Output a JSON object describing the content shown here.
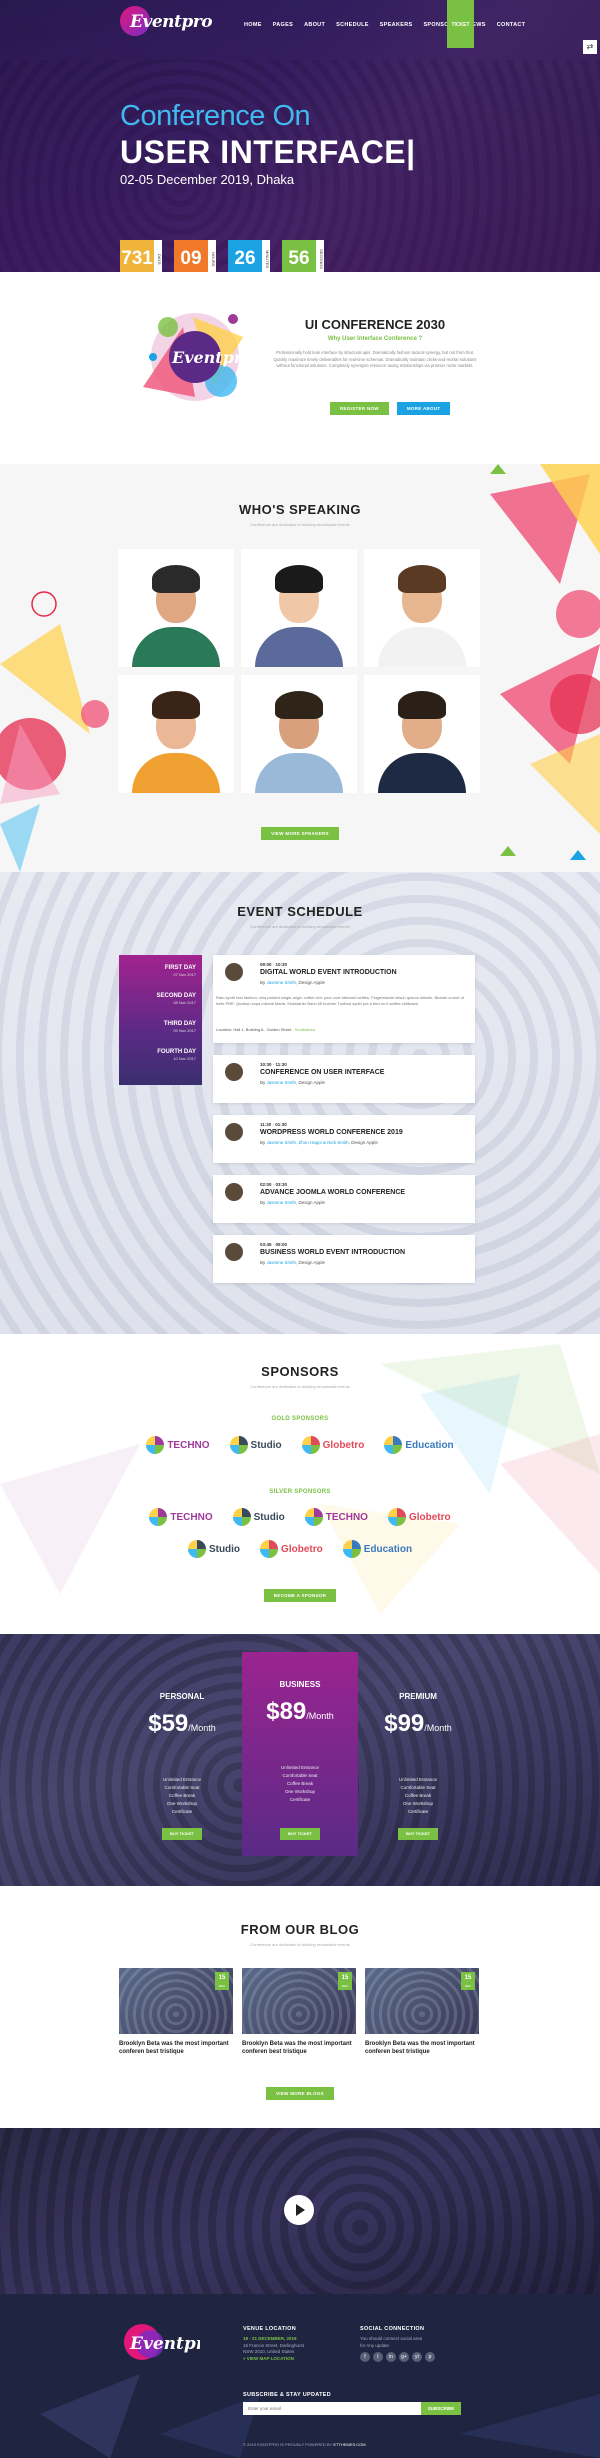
{
  "nav": {
    "logo": "Eventpro",
    "items": [
      "HOME",
      "PAGES",
      "ABOUT",
      "SCHEDULE",
      "SPEAKERS",
      "SPONSORS",
      "NEWS",
      "CONTACT"
    ],
    "ticket": "TICKET",
    "share_icon": "share-icon"
  },
  "hero": {
    "title_line1": "Conference On",
    "title_line2": "USER INTERFACE|",
    "subtitle": "02-05 December 2019, Dhaka",
    "countdown": [
      {
        "value": "731",
        "unit": "DAYS",
        "color": "#f0b43a"
      },
      {
        "value": "09",
        "unit": "HOURS",
        "color": "#f07a2a"
      },
      {
        "value": "26",
        "unit": "MINUTES",
        "color": "#1ba2e2"
      },
      {
        "value": "56",
        "unit": "SECONDS",
        "color": "#7ac143"
      }
    ]
  },
  "about": {
    "logo": "Eventpro",
    "title": "UI CONFERENCE 2030",
    "subtitle": "Why User Interface Conference ?",
    "text": "Professionally hold lean interface by structural apis. Dramatically fashion tactical synergy, but not from that. Quickly maximize timely deliverables for real-time schemas. Dramatically maintain clicks-and-mortar solutions without functional solutions. Completely synergize resource taxing relationships via premier niche markets.",
    "register": "REGISTER NOW",
    "more": "MORE ABOUT"
  },
  "speakers": {
    "title": "WHO'S SPEAKING",
    "sub": "Conference are dedicated to building remarkable events",
    "button": "VIEW MORE SPEAKERS",
    "people": [
      {
        "hair": "#2a2a2a",
        "body": "#2a7a5a",
        "skin": "#e0a882"
      },
      {
        "hair": "#1a1a1a",
        "body": "#5a6a9a",
        "skin": "#f0c8a8"
      },
      {
        "hair": "#5a3a22",
        "body": "#f2f2f2",
        "skin": "#e6b690"
      },
      {
        "hair": "#3a2418",
        "body": "#f0a030",
        "skin": "#eab896"
      },
      {
        "hair": "#2e2418",
        "body": "#9ab8d8",
        "skin": "#d8a07c"
      },
      {
        "hair": "#2a2018",
        "body": "#1e2a44",
        "skin": "#e2ae8a"
      }
    ]
  },
  "schedule": {
    "title": "EVENT SCHEDULE",
    "sub": "Conference are dedicated to building remarkable events",
    "days": [
      {
        "name": "FIRST DAY",
        "date": "07 Nov 2017"
      },
      {
        "name": "SECOND DAY",
        "date": "08 Nov 2017"
      },
      {
        "name": "THIRD DAY",
        "date": "09 Nov 2017"
      },
      {
        "name": "FOURTH DAY",
        "date": "10 Nov 2017"
      }
    ],
    "events": [
      {
        "start": "09:00",
        "end": "10:30",
        "title": "DIGITAL WORLD EVENT INTRODUCTION",
        "speakers": "Jasmine Smith",
        "role": ", Design Apple"
      },
      {
        "start": "10:30",
        "end": "11:30",
        "title": "CONFERENCE ON USER INTERFACE",
        "speakers": "Jasmine Smith",
        "role": ", Design Apple"
      },
      {
        "start": "11:30",
        "end": "01:30",
        "title": "WORDPRESS WORLD CONFERENCE 2019",
        "speakers": "Jasmine Smith, Zhon Happi & Nick Smith",
        "role": ", Design Apple"
      },
      {
        "start": "02:00",
        "end": "03:30",
        "title": "ADVANCE JOOMLA WORLD CONFERENCE",
        "speakers": "Jasmine Smith",
        "role": ", Design Apple"
      },
      {
        "start": "03:45",
        "end": "05:00",
        "title": "BUSINESS WORLD EVENT INTRODUCTION",
        "speakers": "Jasmine Smith",
        "role": ", Design Apple"
      }
    ],
    "first_desc": "Rafo synth fast fashion, chia pickled single-origin coffee vice pour-over tattooed selfies. Fingerstache kitsch quinoa mlkshk. Beards cronut of hella PBR. Quatron kopa mlkshk Marfa, Kickstarter Banh Mi butcher Truffaut synth put a bird on it selfies chillwave.",
    "location_label": "Location:",
    "location": "Hall 1, Building A , Golden Street ,",
    "location_city": "Southafrica"
  },
  "sponsors": {
    "title": "SPONSORS",
    "sub": "Conference are dedicated to building remarkable events",
    "gold": "GOLD SPONSORS",
    "silver": "SILVER SPONSORS",
    "button": "BECOME A SPONSOR",
    "gold_logos": [
      {
        "name": "TECHNO",
        "color": "#a03a9a"
      },
      {
        "name": "Studio",
        "color": "#3a4a5a"
      },
      {
        "name": "Globetro",
        "color": "#e04a5a"
      },
      {
        "name": "Education",
        "color": "#3a7ac0"
      }
    ],
    "silver_row1": [
      {
        "name": "TECHNO",
        "color": "#a03a9a"
      },
      {
        "name": "Studio",
        "color": "#3a4a5a"
      },
      {
        "name": "TECHNO",
        "color": "#a03a9a"
      },
      {
        "name": "Globetro",
        "color": "#e04a5a"
      }
    ],
    "silver_row2": [
      {
        "name": "Studio",
        "color": "#3a4a5a"
      },
      {
        "name": "Globetro",
        "color": "#e04a5a"
      },
      {
        "name": "Education",
        "color": "#3a7ac0"
      }
    ]
  },
  "pricing": {
    "plans": [
      {
        "name": "PERSONAL",
        "currency": "$",
        "amount": "59",
        "period": "/Month",
        "features": [
          "Unlimited Entrance",
          "Comfortable Seat",
          "Coffee Break",
          "One Workshop",
          "Certificate"
        ],
        "button": "BUY TICKET"
      },
      {
        "name": "BUSINESS",
        "currency": "$",
        "amount": "89",
        "period": "/Month",
        "features": [
          "Unlimited Entrance",
          "Comfortable Seat",
          "Coffee Break",
          "One Workshop",
          "Certificate"
        ],
        "button": "BUY TICKET"
      },
      {
        "name": "PREMIUM",
        "currency": "$",
        "amount": "99",
        "period": "/Month",
        "features": [
          "Unlimited Entrance",
          "Comfortable Seat",
          "Coffee Break",
          "One Workshop",
          "Certificate"
        ],
        "button": "BUY TICKET"
      }
    ]
  },
  "blog": {
    "title": "FROM OUR BLOG",
    "sub": "Conference are dedicated to building remarkable events",
    "button": "VIEW MORE BLOGS",
    "posts": [
      {
        "day": "15",
        "month": "DEC",
        "title": "Brooklyn Beta was the most important conferen best tristique"
      },
      {
        "day": "15",
        "month": "DEC",
        "title": "Brooklyn Beta was the most important conferen best tristique"
      },
      {
        "day": "15",
        "month": "DEC",
        "title": "Brooklyn Beta was the most important conferen best tristique"
      }
    ]
  },
  "footer": {
    "logo": "Eventpro",
    "venue_head": "VENUE LOCATION",
    "venue_date": "18 - 21 DECEMBER, 2019",
    "venue_addr1": "15 Francis Street, Darlinghurst",
    "venue_addr2": "NSW 2010, United States",
    "venue_map": "» VIEW MAP LOCATION",
    "social_head": "SOCIAL CONNECTION",
    "social_text1": "You should connect social area",
    "social_text2": "for Any update",
    "social_icons": [
      "f",
      "t",
      "in",
      "g+",
      "yt",
      "p"
    ],
    "subscribe_head": "SUBSCRIBE & STAY UPDATED",
    "subscribe_placeholder": "Enter your email",
    "subscribe_btn": "SUBSCRIBE",
    "copyright_pre": "© 2019 EVENTPRO IS PROUDLY POWERED BY",
    "copyright_brand": "ETTHEMES.COM"
  }
}
